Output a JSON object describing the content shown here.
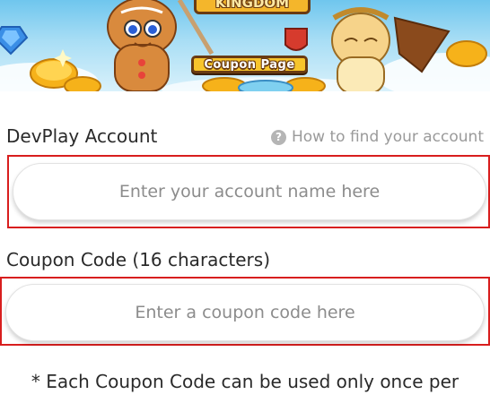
{
  "banner": {
    "title_text": "KINGDOM",
    "plate_text": "Coupon Page"
  },
  "account": {
    "label": "DevPlay Account",
    "help_icon": "?",
    "help_text": "How to find your account",
    "placeholder": "Enter your account name here"
  },
  "coupon": {
    "label": "Coupon Code (16 characters)",
    "placeholder": "Enter a coupon code here"
  },
  "note": "* Each Coupon Code can be used only once per",
  "colors": {
    "highlight_border": "#d81e1e",
    "placeholder_text": "#8c8c8c",
    "label_text": "#2a2a2a",
    "help_text": "#9a9a9a"
  }
}
